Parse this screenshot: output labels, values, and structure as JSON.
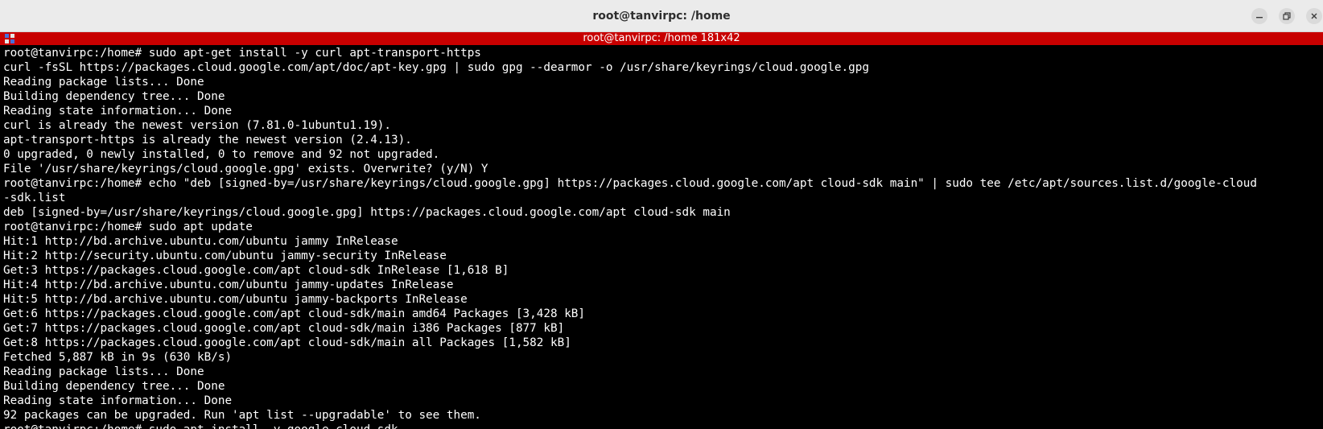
{
  "window": {
    "title": "root@tanvirpc: /home"
  },
  "tab": {
    "title": "root@tanvirpc: /home 181x42",
    "icon": "terminal-app-icon"
  },
  "colors": {
    "tabbar_bg": "#c80000",
    "terminal_bg": "#000000",
    "terminal_fg": "#ffffff",
    "titlebar_bg": "#ebebeb"
  },
  "terminal": {
    "lines": [
      "root@tanvirpc:/home# sudo apt-get install -y curl apt-transport-https",
      "curl -fsSL https://packages.cloud.google.com/apt/doc/apt-key.gpg | sudo gpg --dearmor -o /usr/share/keyrings/cloud.google.gpg",
      "Reading package lists... Done",
      "Building dependency tree... Done",
      "Reading state information... Done",
      "curl is already the newest version (7.81.0-1ubuntu1.19).",
      "apt-transport-https is already the newest version (2.4.13).",
      "0 upgraded, 0 newly installed, 0 to remove and 92 not upgraded.",
      "File '/usr/share/keyrings/cloud.google.gpg' exists. Overwrite? (y/N) Y",
      "root@tanvirpc:/home# echo \"deb [signed-by=/usr/share/keyrings/cloud.google.gpg] https://packages.cloud.google.com/apt cloud-sdk main\" | sudo tee /etc/apt/sources.list.d/google-cloud",
      "-sdk.list",
      "deb [signed-by=/usr/share/keyrings/cloud.google.gpg] https://packages.cloud.google.com/apt cloud-sdk main",
      "root@tanvirpc:/home# sudo apt update",
      "Hit:1 http://bd.archive.ubuntu.com/ubuntu jammy InRelease",
      "Hit:2 http://security.ubuntu.com/ubuntu jammy-security InRelease",
      "Get:3 https://packages.cloud.google.com/apt cloud-sdk InRelease [1,618 B]",
      "Hit:4 http://bd.archive.ubuntu.com/ubuntu jammy-updates InRelease",
      "Hit:5 http://bd.archive.ubuntu.com/ubuntu jammy-backports InRelease",
      "Get:6 https://packages.cloud.google.com/apt cloud-sdk/main amd64 Packages [3,428 kB]",
      "Get:7 https://packages.cloud.google.com/apt cloud-sdk/main i386 Packages [877 kB]",
      "Get:8 https://packages.cloud.google.com/apt cloud-sdk/main all Packages [1,582 kB]",
      "Fetched 5,887 kB in 9s (630 kB/s)",
      "Reading package lists... Done",
      "Building dependency tree... Done",
      "Reading state information... Done",
      "92 packages can be upgraded. Run 'apt list --upgradable' to see them.",
      "root@tanvirpc:/home# sudo apt install -y google-cloud-sdk"
    ]
  }
}
